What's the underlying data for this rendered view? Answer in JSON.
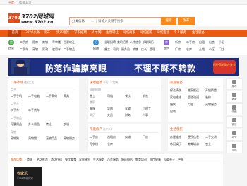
{
  "topbar": {
    "city": "平度",
    "switch": "[切换站点]"
  },
  "header": {
    "logo_mark": "3702",
    "logo_name": "3702同城网",
    "logo_url": "www.3702.cn",
    "search_category": "分类信息",
    "search_placeholder": "请输入关键字搜索",
    "search_button": "搜索",
    "post_button": "发布"
  },
  "nav": {
    "home": "首页",
    "items": [
      "3702头条",
      "房产",
      "资产租赁",
      "求职招聘",
      "人才网",
      "生意转让",
      "同城商家",
      "同城团购",
      "同城活动",
      "个人服务",
      "生活服务"
    ]
  },
  "quick": {
    "groups": [
      {
        "icon": "信",
        "color": "#4aa84a",
        "title": "信息",
        "links": [
          "二手房",
          "租房",
          "商铺",
          "写字楼",
          "生意转让",
          "二手车",
          "宠物",
          "家政",
          "农用车",
          "二手物品"
        ]
      },
      {
        "icon": "招",
        "color": "#2b8be0",
        "title": "招聘",
        "links": [
          "全职招聘",
          "兼职招聘",
          "人才信息",
          "求职简历",
          "普工",
          "司机",
          "服务员",
          "销售",
          "店长",
          "管理"
        ]
      },
      {
        "icon": "房",
        "color": "#8a5ad8",
        "title": "房产",
        "links": [
          "新房",
          "二手房",
          "出租",
          "出售",
          "小区",
          "厂房",
          "仓库",
          "土地",
          "小区",
          "门店"
        ]
      }
    ]
  },
  "banner": {
    "slogan1": "防范诈骗擦亮眼",
    "slogan2": "不理不睬不转款",
    "badge": "保护您的财产安全"
  },
  "panels": {
    "secondhand": {
      "title": "二手市场",
      "subtitle": "便民生活",
      "sections": [
        {
          "label": "二手",
          "cells": [
            "二手手机",
            "二手电脑",
            "二手家电",
            "家具"
          ]
        },
        {
          "label": "二手车",
          "cells": [
            "二手车",
            "二手货车",
            "二手客车",
            "摩托车"
          ]
        },
        {
          "label": "二手物品",
          "cells": [
            "母婴用品",
            "办公用品",
            "转让",
            "农机"
          ]
        },
        {
          "label": "宠物",
          "cells": [
            "宠物狗",
            "宠物猫",
            "宠物用品",
            "宠物服务"
          ]
        }
      ]
    },
    "jobs": {
      "title": "求职招聘",
      "subtitle": "本地人才招聘",
      "sections": [
        {
          "label": "全职招聘",
          "cells": [
            "普工",
            "司机",
            "餐饮",
            "销售"
          ]
        },
        {
          "label": "兼职",
          "cells": [
            "客服",
            "导购",
            "家政",
            "小时工"
          ]
        },
        {
          "label": "简历",
          "cells": [
            "文员",
            "财务",
            "人事",
            "技工"
          ]
        }
      ]
    },
    "estate": {
      "title": "平度房产",
      "subtitle": "房产中介",
      "cells": [
        "二手房",
        "出租房",
        "商铺",
        "厂房",
        "写字楼",
        "仓库"
      ]
    },
    "services": {
      "title": "家庭服务",
      "cells": [
        "保洁清洗",
        "搬家搬运",
        "开锁换锁",
        "家电维修",
        "管道疏通",
        "装修",
        "婚庆",
        "月嫂",
        "宠物服务",
        "回收"
      ]
    },
    "life": {
      "title": "生活便民",
      "cells": [
        "房屋维修",
        "便民信息",
        "二手交易",
        "休闲娱乐",
        "教育培训",
        "农业"
      ]
    }
  },
  "side": [
    "发布",
    "客服",
    "收藏",
    "微信",
    "APP",
    "顶部"
  ],
  "store": {
    "tabs": [
      "推荐店铺",
      "商城",
      "名店推荐",
      "酒店住宿",
      "餐饮美食",
      "家居建材",
      "生活服务",
      "汽车服务",
      "婚纱摄影",
      "教育培训",
      "医疗健康",
      "母婴亲子",
      "更多"
    ],
    "image_title": "农家乐",
    "image_sub": "3702同城商家"
  }
}
